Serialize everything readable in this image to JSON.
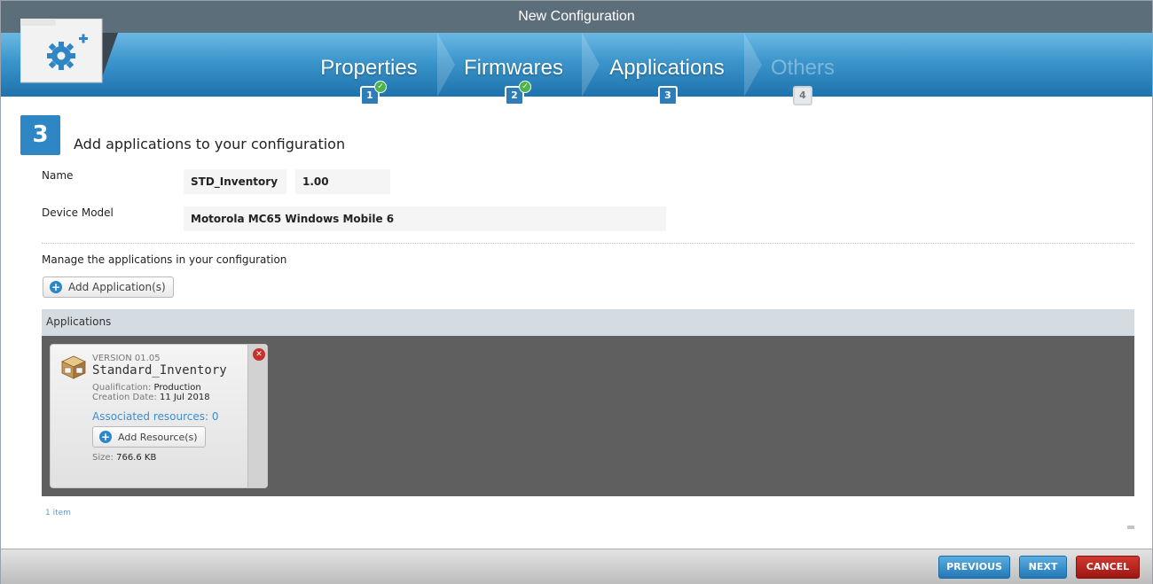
{
  "window": {
    "title": "New Configuration"
  },
  "wizard": {
    "steps": [
      {
        "label": "Properties",
        "number": "1",
        "state": "completed"
      },
      {
        "label": "Firmwares",
        "number": "2",
        "state": "completed"
      },
      {
        "label": "Applications",
        "number": "3",
        "state": "active"
      },
      {
        "label": "Others",
        "number": "4",
        "state": "disabled"
      }
    ],
    "current_step_number": "3",
    "heading": "Add applications to your configuration"
  },
  "form": {
    "name_label": "Name",
    "name_value": "STD_Inventory",
    "version_value": "1.00",
    "device_model_label": "Device Model",
    "device_model_value": "Motorola MC65 Windows Mobile 6"
  },
  "applications": {
    "manage_text": "Manage the applications in your configuration",
    "add_button": "Add Application(s)",
    "header": "Applications",
    "items": [
      {
        "version": "VERSION 01.05",
        "name": "Standard_Inventory",
        "qualification_label": "Qualification:",
        "qualification_value": "Production",
        "creation_label": "Creation Date:",
        "creation_value": "11 Jul 2018",
        "associated_resources": "Associated resources: 0",
        "add_resource_button": "Add Resource(s)",
        "size_label": "Size:",
        "size_value": "766.6 KB"
      }
    ],
    "count_text": "1 item"
  },
  "footer": {
    "previous": "PREVIOUS",
    "next": "NEXT",
    "cancel": "CANCEL"
  },
  "colors": {
    "accent": "#2e86c4",
    "cancel": "#b01e18",
    "titlebar": "#5d6e7b"
  }
}
